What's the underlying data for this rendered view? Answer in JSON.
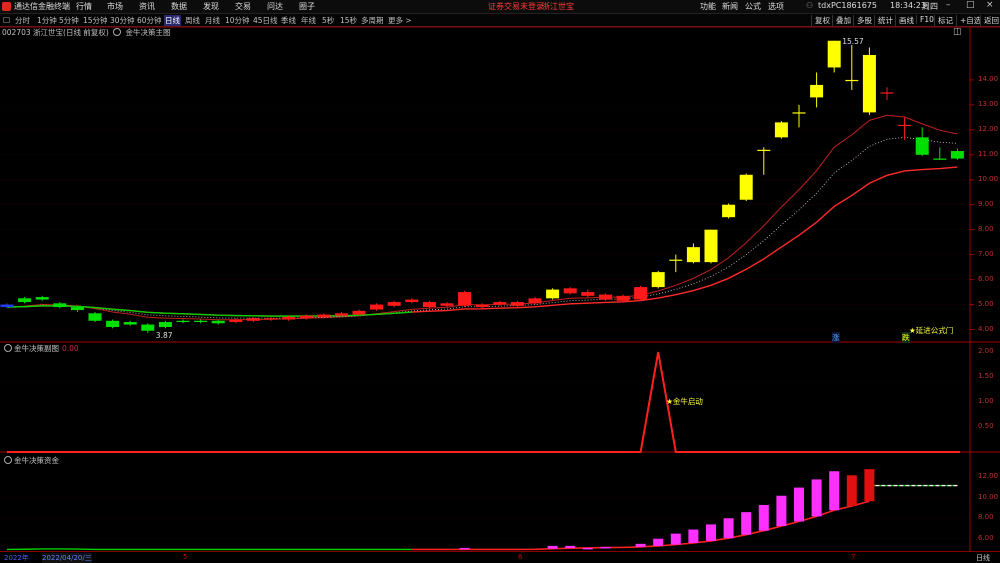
{
  "titlebar": {
    "app_name": "通达信金融终端",
    "menus": [
      "行情",
      "市场",
      "资讯",
      "数据",
      "发现",
      "交易",
      "问达",
      "圈子"
    ],
    "promo_login": "证券交易未登录",
    "promo_stock": "浙江世宝",
    "right_menus": [
      "功能",
      "新闻",
      "公式",
      "选项"
    ],
    "account": "tdxPC1861675",
    "time": "18:34:23",
    "weekday": "周四"
  },
  "periodbar": {
    "toggle": "□",
    "periods": [
      "分时",
      "1分钟",
      "5分钟",
      "15分钟",
      "30分钟",
      "60分钟",
      "日线",
      "周线",
      "月线",
      "10分钟",
      "45日线",
      "季线",
      "年线",
      "5秒",
      "15秒",
      "多周期",
      "更多 >"
    ],
    "active": "日线",
    "tools": [
      "复权",
      "叠加",
      "多股",
      "统计",
      "画线",
      "F10",
      "标记",
      "+自选",
      "返回"
    ]
  },
  "main_panel": {
    "title": "002703 浙江世宝(日线 前复权)",
    "indicator": "金牛决策主图",
    "high_label": "15.57",
    "low_label": "3.87",
    "yaxis": [
      "14.00",
      "13.00",
      "12.00",
      "11.00",
      "10.00",
      "9.00",
      "8.00",
      "7.00",
      "6.00",
      "5.00",
      "4.00"
    ],
    "marker_zhang": "涨",
    "marker_die": "跌",
    "annotation": "★延进公式门"
  },
  "sub_panel1": {
    "title": "金牛决策副图",
    "value": "0.00",
    "yaxis": [
      "2.00",
      "1.50",
      "1.00",
      "0.50"
    ],
    "annotation": "★金牛启动"
  },
  "sub_panel2": {
    "title": "金牛决策资金",
    "yaxis": [
      "12.00",
      "10.00",
      "8.00",
      "6.00"
    ]
  },
  "xaxis": {
    "labels": [
      "2022年",
      "2022/04/20/三",
      "5",
      "6",
      "7"
    ],
    "period_tag": "日线"
  },
  "colors": {
    "up": "#ff2020",
    "down": "#00e000",
    "yellow": "#ffff00",
    "magenta": "#ff30ff",
    "grid": "#3a0000",
    "axis": "#a00000"
  },
  "chart_data": {
    "type": "candlestick",
    "candles": [
      {
        "o": 5.0,
        "c": 4.9,
        "h": 5.05,
        "l": 4.85,
        "k": "blue"
      },
      {
        "o": 5.25,
        "c": 5.1,
        "h": 5.3,
        "l": 5.05,
        "k": "green"
      },
      {
        "o": 5.2,
        "c": 5.3,
        "h": 5.35,
        "l": 5.15,
        "k": "green"
      },
      {
        "o": 5.05,
        "c": 4.9,
        "h": 5.1,
        "l": 4.85,
        "k": "green"
      },
      {
        "o": 4.9,
        "c": 4.78,
        "h": 4.95,
        "l": 4.7,
        "k": "green"
      },
      {
        "o": 4.65,
        "c": 4.35,
        "h": 4.7,
        "l": 4.3,
        "k": "green"
      },
      {
        "o": 4.35,
        "c": 4.1,
        "h": 4.4,
        "l": 4.05,
        "k": "green"
      },
      {
        "o": 4.3,
        "c": 4.2,
        "h": 4.35,
        "l": 4.15,
        "k": "green"
      },
      {
        "o": 4.2,
        "c": 3.95,
        "h": 4.25,
        "l": 3.87,
        "k": "green"
      },
      {
        "o": 4.1,
        "c": 4.3,
        "h": 4.35,
        "l": 4.05,
        "k": "green"
      },
      {
        "o": 4.3,
        "c": 4.35,
        "h": 4.4,
        "l": 4.25,
        "k": "green"
      },
      {
        "o": 4.3,
        "c": 4.35,
        "h": 4.4,
        "l": 4.25,
        "k": "green"
      },
      {
        "o": 4.35,
        "c": 4.25,
        "h": 4.4,
        "l": 4.2,
        "k": "green"
      },
      {
        "o": 4.3,
        "c": 4.4,
        "h": 4.45,
        "l": 4.25,
        "k": "red"
      },
      {
        "o": 4.35,
        "c": 4.45,
        "h": 4.5,
        "l": 4.3,
        "k": "red"
      },
      {
        "o": 4.4,
        "c": 4.45,
        "h": 4.5,
        "l": 4.35,
        "k": "red"
      },
      {
        "o": 4.4,
        "c": 4.5,
        "h": 4.55,
        "l": 4.35,
        "k": "red"
      },
      {
        "o": 4.45,
        "c": 4.55,
        "h": 4.6,
        "l": 4.4,
        "k": "red"
      },
      {
        "o": 4.5,
        "c": 4.6,
        "h": 4.65,
        "l": 4.45,
        "k": "red"
      },
      {
        "o": 4.55,
        "c": 4.65,
        "h": 4.7,
        "l": 4.5,
        "k": "red"
      },
      {
        "o": 4.6,
        "c": 4.75,
        "h": 4.8,
        "l": 4.55,
        "k": "red"
      },
      {
        "o": 4.8,
        "c": 5.0,
        "h": 5.05,
        "l": 4.75,
        "k": "red"
      },
      {
        "o": 4.95,
        "c": 5.1,
        "h": 5.15,
        "l": 4.9,
        "k": "red"
      },
      {
        "o": 5.1,
        "c": 5.2,
        "h": 5.25,
        "l": 5.05,
        "k": "red"
      },
      {
        "o": 4.9,
        "c": 5.1,
        "h": 5.15,
        "l": 4.85,
        "k": "red"
      },
      {
        "o": 4.95,
        "c": 5.05,
        "h": 5.1,
        "l": 4.9,
        "k": "red"
      },
      {
        "o": 4.95,
        "c": 5.5,
        "h": 5.55,
        "l": 4.9,
        "k": "red"
      },
      {
        "o": 5.0,
        "c": 4.9,
        "h": 5.05,
        "l": 4.85,
        "k": "red"
      },
      {
        "o": 5.0,
        "c": 5.1,
        "h": 5.15,
        "l": 4.95,
        "k": "red"
      },
      {
        "o": 4.95,
        "c": 5.1,
        "h": 5.15,
        "l": 4.9,
        "k": "red"
      },
      {
        "o": 5.05,
        "c": 5.25,
        "h": 5.3,
        "l": 5.0,
        "k": "red"
      },
      {
        "o": 5.25,
        "c": 5.6,
        "h": 5.65,
        "l": 5.2,
        "k": "yellow"
      },
      {
        "o": 5.45,
        "c": 5.65,
        "h": 5.7,
        "l": 5.4,
        "k": "red"
      },
      {
        "o": 5.5,
        "c": 5.35,
        "h": 5.6,
        "l": 5.3,
        "k": "red"
      },
      {
        "o": 5.2,
        "c": 5.4,
        "h": 5.45,
        "l": 5.15,
        "k": "red"
      },
      {
        "o": 5.15,
        "c": 5.35,
        "h": 5.4,
        "l": 5.1,
        "k": "red"
      },
      {
        "o": 5.2,
        "c": 5.7,
        "h": 5.75,
        "l": 5.15,
        "k": "red"
      },
      {
        "o": 5.7,
        "c": 6.3,
        "h": 6.35,
        "l": 5.65,
        "k": "yellow"
      },
      {
        "o": 6.8,
        "c": 6.8,
        "h": 7.0,
        "l": 6.3,
        "k": "yellow"
      },
      {
        "o": 6.7,
        "c": 7.3,
        "h": 7.45,
        "l": 6.65,
        "k": "yellow"
      },
      {
        "o": 6.7,
        "c": 8.0,
        "h": 8.0,
        "l": 6.65,
        "k": "yellow"
      },
      {
        "o": 8.5,
        "c": 9.0,
        "h": 9.05,
        "l": 8.45,
        "k": "yellow"
      },
      {
        "o": 9.2,
        "c": 10.2,
        "h": 10.25,
        "l": 9.15,
        "k": "yellow"
      },
      {
        "o": 11.2,
        "c": 11.2,
        "h": 11.3,
        "l": 10.2,
        "k": "yellow"
      },
      {
        "o": 11.7,
        "c": 12.3,
        "h": 12.35,
        "l": 11.65,
        "k": "yellow"
      },
      {
        "o": 12.7,
        "c": 12.7,
        "h": 13.0,
        "l": 12.1,
        "k": "yellow"
      },
      {
        "o": 13.3,
        "c": 13.8,
        "h": 14.3,
        "l": 12.9,
        "k": "yellow"
      },
      {
        "o": 14.5,
        "c": 15.57,
        "h": 15.57,
        "l": 14.3,
        "k": "yellow"
      },
      {
        "o": 14.0,
        "c": 14.0,
        "h": 15.4,
        "l": 13.6,
        "k": "yellow"
      },
      {
        "o": 12.7,
        "c": 15.0,
        "h": 15.3,
        "l": 12.6,
        "k": "yellow"
      },
      {
        "o": 13.5,
        "c": 13.5,
        "h": 13.7,
        "l": 13.2,
        "k": "red"
      },
      {
        "o": 12.2,
        "c": 12.2,
        "h": 12.5,
        "l": 11.6,
        "k": "red"
      },
      {
        "o": 11.7,
        "c": 11.0,
        "h": 12.1,
        "l": 10.95,
        "k": "green"
      },
      {
        "o": 10.85,
        "c": 10.85,
        "h": 11.3,
        "l": 10.8,
        "k": "green"
      },
      {
        "o": 10.85,
        "c": 11.15,
        "h": 11.25,
        "l": 10.8,
        "k": "green"
      }
    ],
    "ylim": [
      3.5,
      15.8
    ],
    "signal": {
      "peak_index": 37,
      "value": 2.0,
      "ylim": [
        0,
        2.1
      ]
    },
    "fund_bars": [
      {
        "i": 26,
        "v": 5.1
      },
      {
        "i": 31,
        "v": 5.3
      },
      {
        "i": 32,
        "v": 5.3
      },
      {
        "i": 33,
        "v": 5.1
      },
      {
        "i": 34,
        "v": 5.2
      },
      {
        "i": 36,
        "v": 5.5
      },
      {
        "i": 37,
        "v": 6.0
      },
      {
        "i": 38,
        "v": 6.5
      },
      {
        "i": 39,
        "v": 6.9
      },
      {
        "i": 40,
        "v": 7.4
      },
      {
        "i": 41,
        "v": 8.0
      },
      {
        "i": 42,
        "v": 8.6
      },
      {
        "i": 43,
        "v": 9.3
      },
      {
        "i": 44,
        "v": 10.2
      },
      {
        "i": 45,
        "v": 11.0
      },
      {
        "i": 46,
        "v": 11.8
      },
      {
        "i": 47,
        "v": 12.6
      },
      {
        "i": 48,
        "v": 12.2,
        "red": true
      },
      {
        "i": 49,
        "v": 12.8,
        "red": true
      }
    ],
    "fund_ylim": [
      4.8,
      13.6
    ]
  }
}
